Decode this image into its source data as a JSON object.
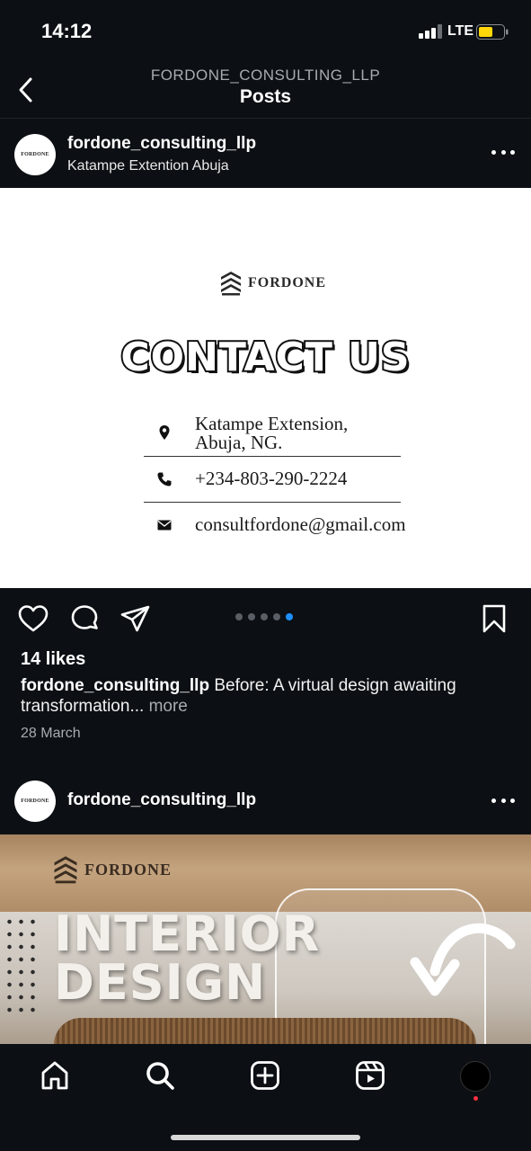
{
  "status_bar": {
    "time": "14:12",
    "network": "LTE"
  },
  "nav": {
    "account": "FORDONE_CONSULTING_LLP",
    "title": "Posts"
  },
  "post1": {
    "username": "fordone_consulting_llp",
    "location": "Katampe Extention Abuja",
    "avatar_text": "FORDONE",
    "image": {
      "brand": "FORDONE",
      "heading": "CONTACT US",
      "address_line1": "Katampe Extension,",
      "address_line2": "Abuja, NG.",
      "phone": "+234-803-290-2224",
      "email": "consultfordone@gmail.com"
    },
    "carousel": {
      "count": 5,
      "active_index": 4
    },
    "likes": "14 likes",
    "caption_user": "fordone_consulting_llp",
    "caption_text": "Before: A virtual design awaiting transformation...",
    "caption_more": "more",
    "date": "28 March"
  },
  "post2": {
    "username": "fordone_consulting_llp",
    "avatar_text": "FORDONE",
    "image": {
      "brand": "FORDONE",
      "line1": "INTERIOR",
      "line2": "DESIGN"
    }
  },
  "colors": {
    "background": "#0c1014",
    "accent": "#1e90ff",
    "notification": "#ff3040"
  },
  "tabs": [
    "home-icon",
    "search-icon",
    "create-icon",
    "reels-icon",
    "profile-avatar"
  ]
}
